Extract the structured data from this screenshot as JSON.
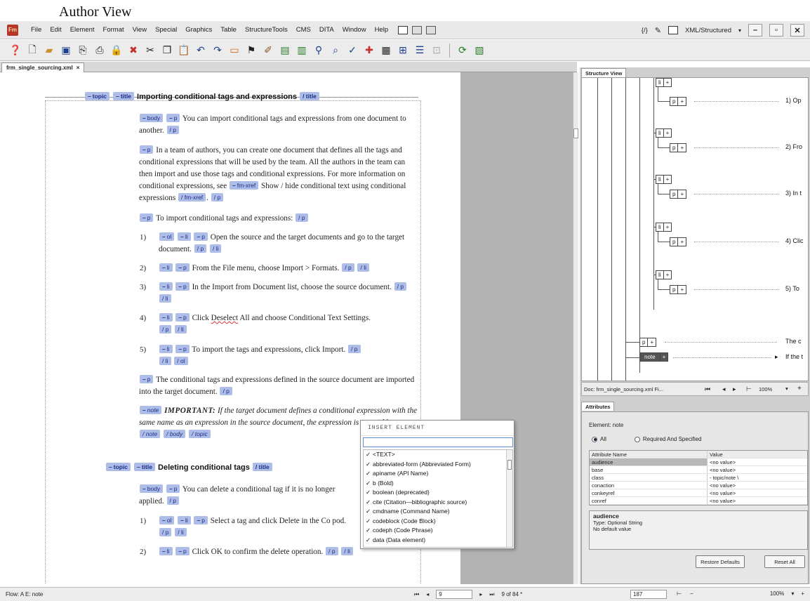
{
  "caption": "Author View",
  "app": {
    "logo": "Fm",
    "menus": [
      "File",
      "Edit",
      "Element",
      "Format",
      "View",
      "Special",
      "Graphics",
      "Table",
      "StructureTools",
      "CMS",
      "DITA",
      "Window",
      "Help"
    ],
    "code_icon_label": "{/}",
    "workspace": "XML/Structured",
    "window_buttons": [
      "–",
      "▫",
      "✕"
    ]
  },
  "toolbar_icons": [
    "help-icon",
    "new-doc-icon",
    "open-folder-icon",
    "save-icon",
    "import-icon",
    "print-icon",
    "lock-icon",
    "delete-icon",
    "cut-icon",
    "copy-icon",
    "paste-icon",
    "undo-icon",
    "redo-icon",
    "bookmark-icon",
    "spellcheck-icon",
    "insert-table-icon",
    "chart-icon",
    "zoom-icon",
    "search-icon"
  ],
  "document": {
    "tab_name": "frm_single_sourcing.xml",
    "tab_close": "×",
    "topic1": {
      "heading": "Importing conditional tags and expressions",
      "body_p1": "You can import conditional tags and expressions from one document to another.",
      "p2": "In a team of authors, you can create one document that defines all the tags and conditional expressions that will be used by the team. All the authors in the team can then import and use those tags and conditional expressions. For more information on conditional expressions, see",
      "xref_text": "Show / hide conditional text using conditional expressions",
      "p3": "To import conditional tags and expressions:",
      "steps": [
        {
          "num": "1)",
          "text": "Open the source and the target documents and go to the target document."
        },
        {
          "num": "2)",
          "text": "From the File menu, choose Import > Formats."
        },
        {
          "num": "3)",
          "text": "In the Import from Document list, choose the source document."
        },
        {
          "num": "4)",
          "text_a": "Click",
          "text_b": "Deselect",
          "text_c": "All and choose Conditional Text Settings."
        },
        {
          "num": "5)",
          "text": "To import the tags and expressions, click Import."
        }
      ],
      "p4": "The conditional tags and expressions defined in the source document are imported into the target document.",
      "note_label": "IMPORTANT:",
      "note_text": "If the target document defines a conditional expression with the same name as an expression in the source document, the expression is overridden."
    },
    "topic2": {
      "heading": "Deleting conditional tags",
      "body_p1": "You can delete a conditional tag if it is no longer applied.",
      "steps": [
        {
          "num": "1)",
          "text": "Select a tag and click Delete in the Co pod."
        },
        {
          "num": "2)",
          "text": "Click OK to confirm the delete operation."
        }
      ]
    },
    "tags": {
      "topic": "topic",
      "title": "title",
      "title_end": "/ title",
      "body": "body",
      "p": "p",
      "p_end": "/ p",
      "ol": "ol",
      "ol_end": "/ ol",
      "li": "li",
      "li_end": "/ li",
      "xref": "fm-xref",
      "xref_end": "/ fm-xref",
      "note": "note",
      "note_end": "/ note",
      "body_end": "/ body",
      "topic_end": "/ topic"
    }
  },
  "insert_element": {
    "title": "INSERT ELEMENT",
    "input_value": "",
    "items": [
      "<TEXT>",
      "abbreviated-form (Abbreviated Form)",
      "apiname (API Name)",
      "b (Bold)",
      "boolean (deprecated)",
      "cite (Citation—bibliographic source)",
      "cmdname (Command Name)",
      "codeblock (Code Block)",
      "codeph (Code Phrase)",
      "data (Data element)"
    ]
  },
  "structure_view": {
    "tab": "Structure View",
    "li_label": "li",
    "p_label": "p",
    "plus": "+",
    "note_label": "note",
    "texts": [
      "1) Op",
      "2) Fro",
      "3) In t",
      "4) Clic",
      "5) To",
      "The c",
      "If the t"
    ],
    "footer_doc": "Doc: frm_single_sourcing.xml Fi...",
    "footer_zoom": "100%"
  },
  "attributes": {
    "tab": "Attributes",
    "element_label": "Element: note",
    "radio_all": "All",
    "radio_required": "Required And Specified",
    "col_name": "Attribute Name",
    "col_value": "Value",
    "rows": [
      {
        "name": "audience",
        "value": "<no value>"
      },
      {
        "name": "base",
        "value": "<no value>"
      },
      {
        "name": "class",
        "value": "- topic/note \\"
      },
      {
        "name": "conaction",
        "value": "<no value>"
      },
      {
        "name": "conkeyref",
        "value": "<no value>"
      },
      {
        "name": "conref",
        "value": "<no value>"
      }
    ],
    "desc_title": "audience",
    "desc_type": "Type: Optional String",
    "desc_default": "No default value",
    "restore_button": "Restore Defaults",
    "reset_button": "Reset All"
  },
  "status": {
    "flow": "Flow: A  E: note",
    "page_value": "9",
    "page_of": "9 of 84 *",
    "zoom_value": "187",
    "zoom_pct": "100%"
  }
}
